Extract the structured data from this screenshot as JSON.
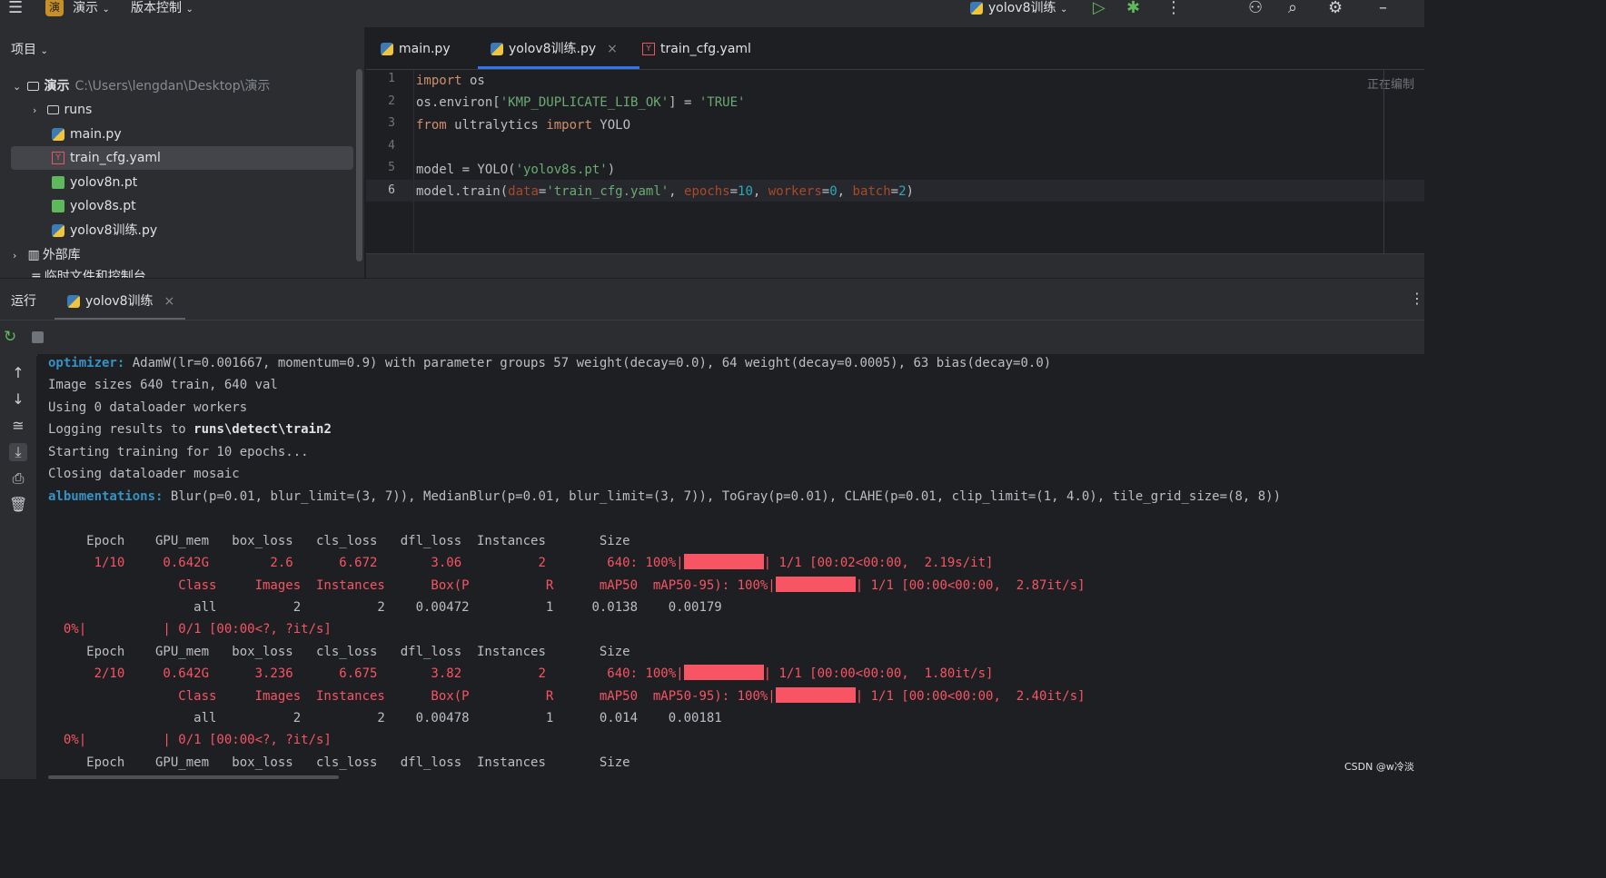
{
  "titlebar": {
    "project_badge": "演",
    "project_name": "演示",
    "vcs": "版本控制",
    "run_config": "yolov8训练"
  },
  "project_panel": {
    "header": "项目",
    "root_name": "演示",
    "root_path": "C:\\Users\\lengdan\\Desktop\\演示",
    "items": [
      {
        "label": "runs"
      },
      {
        "label": "main.py"
      },
      {
        "label": "train_cfg.yaml"
      },
      {
        "label": "yolov8n.pt"
      },
      {
        "label": "yolov8s.pt"
      },
      {
        "label": "yolov8训练.py"
      }
    ],
    "external_libs": "外部库",
    "scratches": "临时文件和控制台"
  },
  "editor": {
    "tabs": [
      {
        "label": "main.py"
      },
      {
        "label": "yolov8训练.py"
      },
      {
        "label": "train_cfg.yaml"
      }
    ],
    "reader_mode": "正在编制",
    "line_numbers": [
      "1",
      "2",
      "3",
      "4",
      "5",
      "6"
    ]
  },
  "run": {
    "title": "运行",
    "tab_label": "yolov8训练"
  },
  "console": {
    "optimizer_label": "optimizer:",
    "optimizer_text": " AdamW(lr=0.001667, momentum=0.9) with parameter groups 57 weight(decay=0.0), 64 weight(decay=0.0005), 63 bias(decay=0.0)",
    "image_sizes": "Image sizes 640 train, 640 val",
    "workers": "Using 0 dataloader workers",
    "logging_prefix": "Logging results to ",
    "logging_path": "runs\\detect\\train2",
    "starting": "Starting training for 10 epochs...",
    "closing": "Closing dataloader mosaic",
    "albu_label": "albumentations:",
    "albu_text": " Blur(p=0.01, blur_limit=(3, 7)), MedianBlur(p=0.01, blur_limit=(3, 7)), ToGray(p=0.01), CLAHE(p=0.01, clip_limit=(1, 4.0), tile_grid_size=(8, 8))",
    "epoch_header": "     Epoch    GPU_mem   box_loss   cls_loss   dfl_loss  Instances       Size",
    "e1_prefix": "      1/10     0.642G        2.6      6.672       3.06          2        640: 100%|",
    "e1_suffix": "| 1/1 [00:02<00:00,  2.19s/it]",
    "val_prefix": "                 Class     Images  Instances      Box(P          R      mAP50  mAP50-95): 100%|",
    "v1_suffix": "| 1/1 [00:00<00:00,  2.87it/s]",
    "a1": "                   all          2          2    0.00472          1     0.0138    0.00179",
    "zero": "  0%|          | 0/1 [00:00<?, ?it/s]",
    "e2_prefix": "      2/10     0.642G      3.236      6.675       3.82          2        640: 100%|",
    "e2_suffix": "| 1/1 [00:00<00:00,  1.80it/s]",
    "v2_suffix": "| 1/1 [00:00<00:00,  2.40it/s]",
    "a2": "                   all          2          2    0.00478          1      0.014    0.00181"
  },
  "watermark": "CSDN @w冷淡"
}
